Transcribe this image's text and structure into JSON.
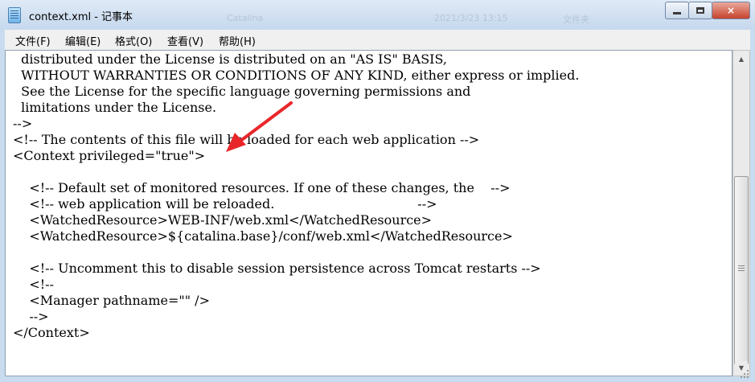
{
  "window": {
    "title": "context.xml - 记事本",
    "background_text": [
      "Catalina",
      "2021/3/23 13:15",
      "文件夹"
    ],
    "buttons": {
      "minimize": "minimize-icon",
      "maximize": "maximize-icon",
      "close": "×"
    }
  },
  "menu": {
    "items": [
      {
        "label": "文件(F)"
      },
      {
        "label": "编辑(E)"
      },
      {
        "label": "格式(O)"
      },
      {
        "label": "查看(V)"
      },
      {
        "label": "帮助(H)"
      }
    ]
  },
  "editor": {
    "lines": [
      "  distributed under the License is distributed on an \"AS IS\" BASIS,",
      "  WITHOUT WARRANTIES OR CONDITIONS OF ANY KIND, either express or implied.",
      "  See the License for the specific language governing permissions and",
      "  limitations under the License.",
      "-->",
      "<!-- The contents of this file will be loaded for each web application -->",
      "<Context privileged=\"true\">",
      "",
      "    <!-- Default set of monitored resources. If one of these changes, the    -->",
      "    <!-- web application will be reloaded.                                   -->",
      "    <WatchedResource>WEB-INF/web.xml</WatchedResource>",
      "    <WatchedResource>${catalina.base}/conf/web.xml</WatchedResource>",
      "",
      "    <!-- Uncomment this to disable session persistence across Tomcat restarts -->",
      "    <!--",
      "    <Manager pathname=\"\" />",
      "    -->",
      "</Context>"
    ]
  },
  "annotation": {
    "color": "#e8262a"
  },
  "colors": {
    "titlebar": "#c5d8ed",
    "menubar": "#f0f0f0",
    "editor_bg": "#ffffff",
    "close_button": "#c7432e"
  }
}
